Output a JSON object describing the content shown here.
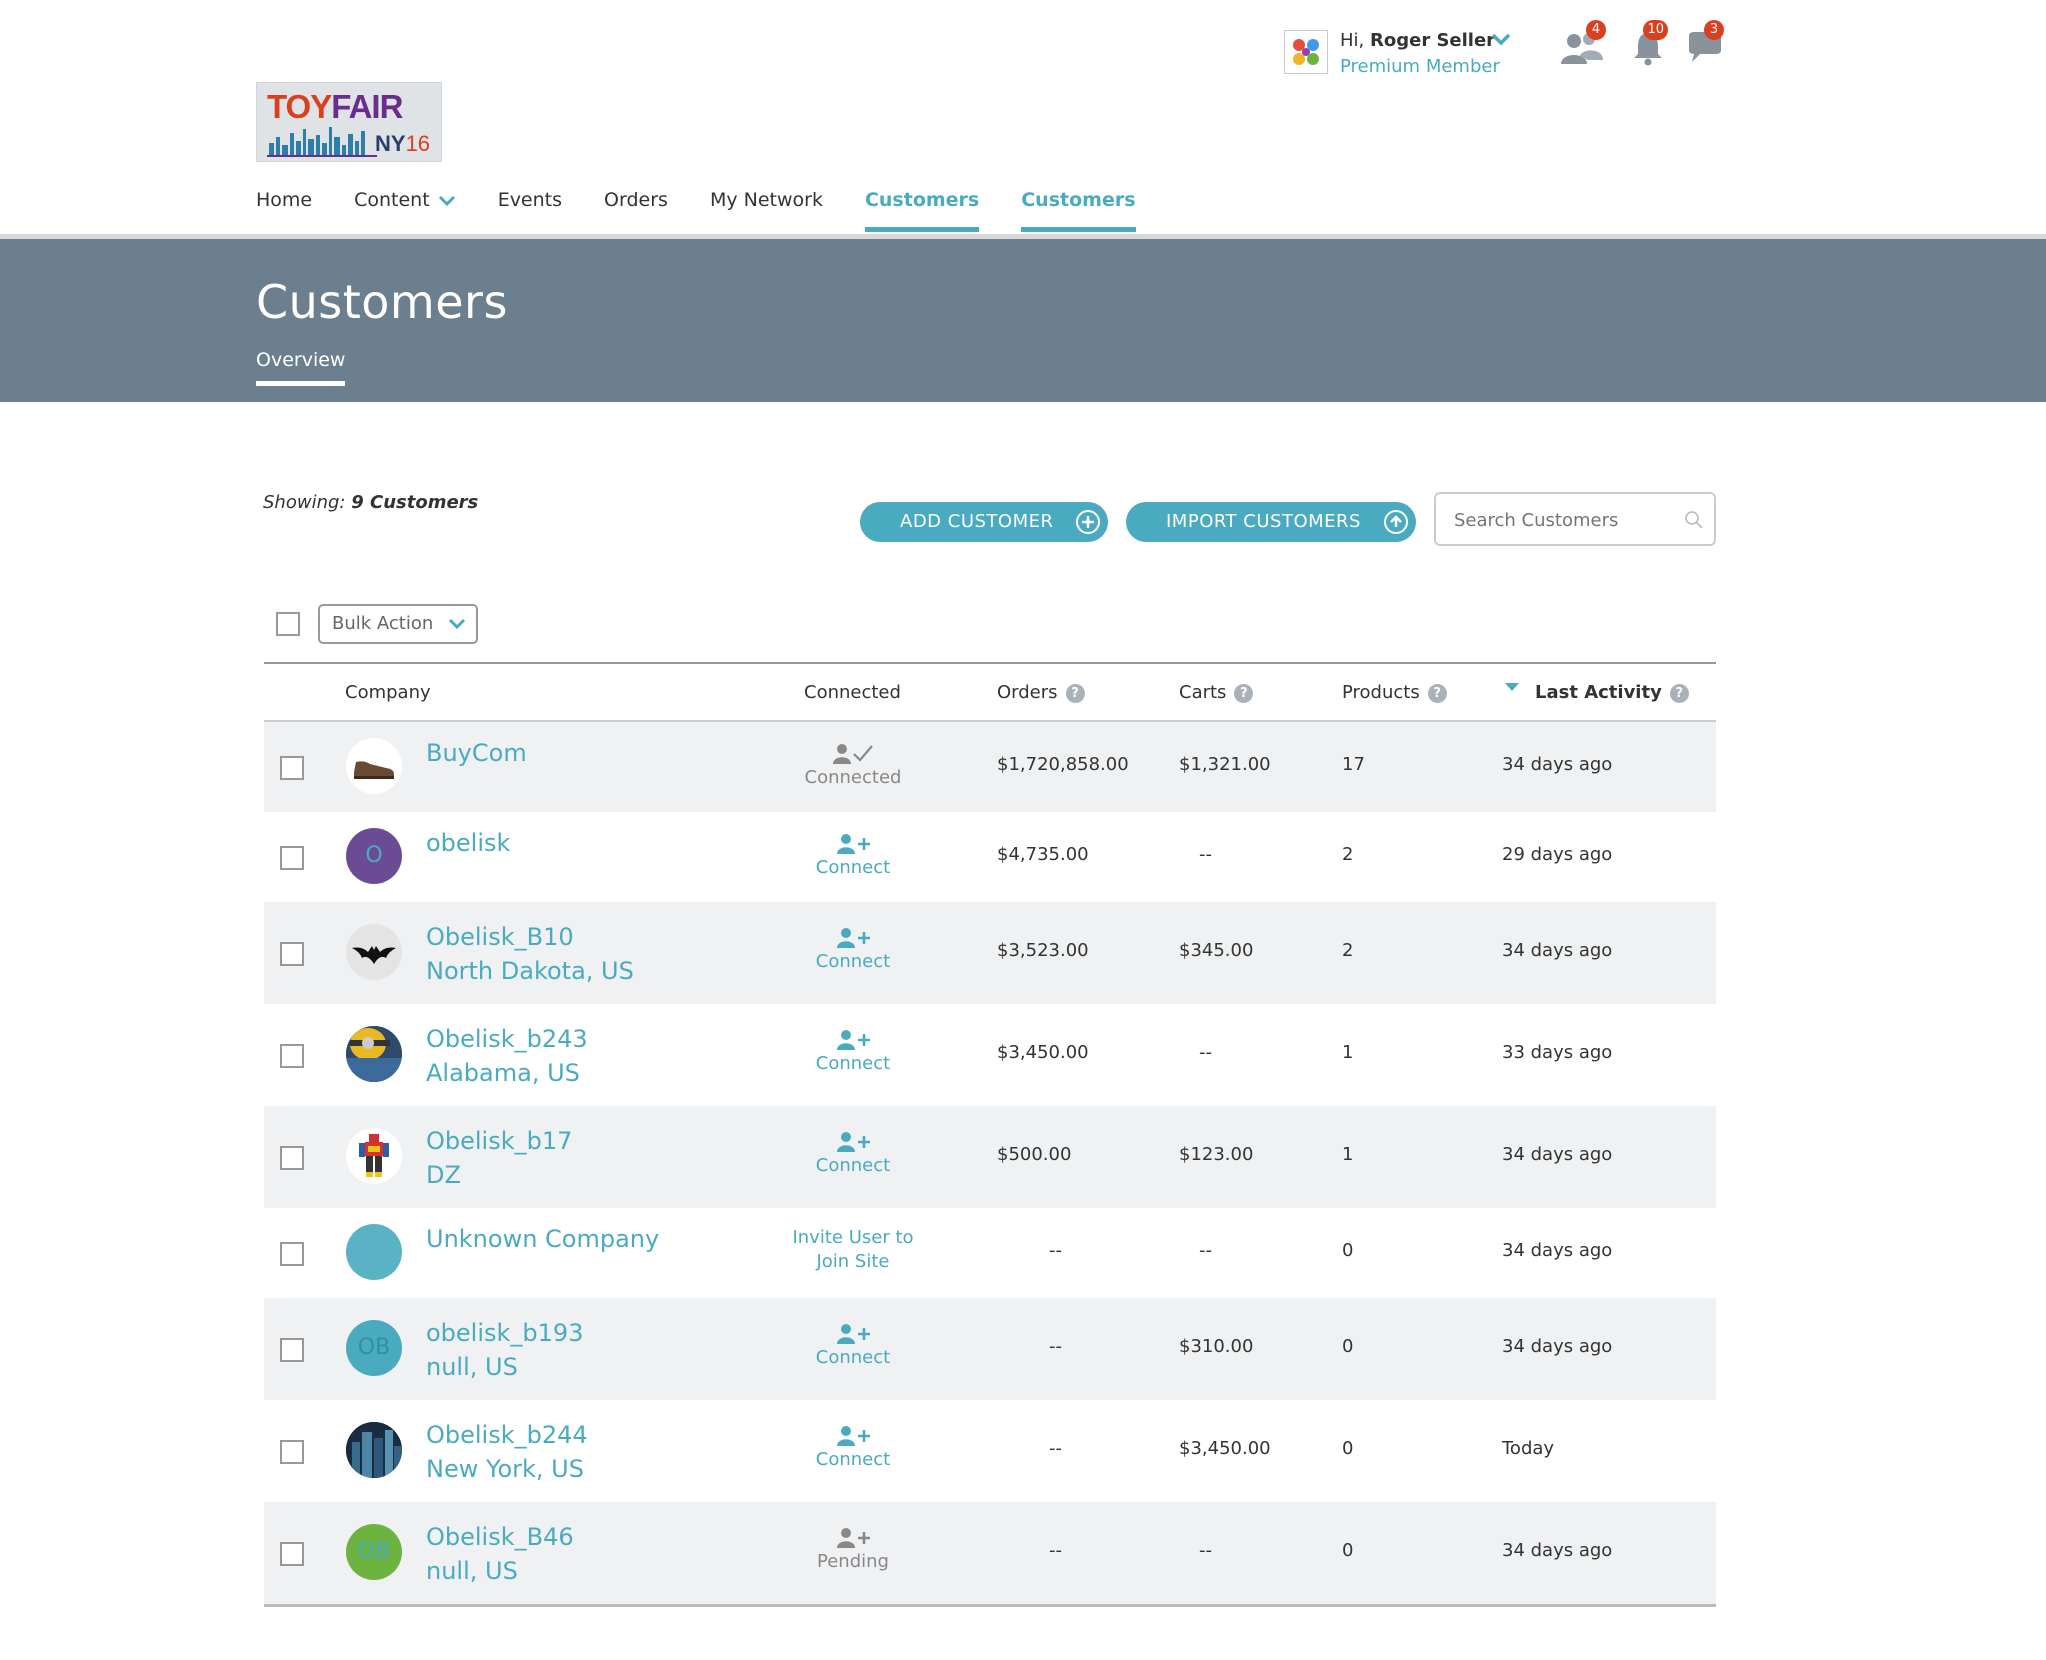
{
  "logo": {
    "toy": "TOY",
    "fair": "FAIR",
    "ny": "NY",
    "year": "16"
  },
  "user": {
    "greeting": "Hi,",
    "name": "Roger Seller",
    "level": "Premium Member"
  },
  "notifications": {
    "network": "4",
    "alerts": "10",
    "messages": "3"
  },
  "nav": [
    "Home",
    "Content",
    "Events",
    "Orders",
    "My Network",
    "Customers",
    "Customers"
  ],
  "banner": {
    "title": "Customers",
    "tab": "Overview"
  },
  "toolbar": {
    "showing_label": "Showing:",
    "showing_value": "9 Customers",
    "add_button": "ADD CUSTOMER",
    "import_button": "IMPORT CUSTOMERS",
    "search_placeholder": "Search Customers",
    "bulk_action": "Bulk Action"
  },
  "columns": {
    "company": "Company",
    "connected": "Connected",
    "orders": "Orders",
    "carts": "Carts",
    "products": "Products",
    "last_activity": "Last Activity",
    "help": "?"
  },
  "rows": [
    {
      "name": "BuyCom",
      "location": "",
      "status": "Connected",
      "orders": "$1,720,858.00",
      "carts": "$1,321.00",
      "products": "17",
      "activity": "34 days ago",
      "avatar": "shoe-image"
    },
    {
      "name": "obelisk",
      "location": "",
      "status": "Connect",
      "orders": "$4,735.00",
      "carts": "--",
      "products": "2",
      "activity": "29 days ago",
      "avatar_text": "O",
      "avatar_color": "#6b4c94"
    },
    {
      "name": "Obelisk_B10",
      "location": "North Dakota, US",
      "status": "Connect",
      "orders": "$3,523.00",
      "carts": "$345.00",
      "products": "2",
      "activity": "34 days ago",
      "avatar": "bat-image"
    },
    {
      "name": "Obelisk_b243",
      "location": "Alabama, US",
      "status": "Connect",
      "orders": "$3,450.00",
      "carts": "--",
      "products": "1",
      "activity": "33 days ago",
      "avatar": "minion-image"
    },
    {
      "name": "Obelisk_b17",
      "location": "DZ",
      "status": "Connect",
      "orders": "$500.00",
      "carts": "$123.00",
      "products": "1",
      "activity": "34 days ago",
      "avatar": "robot-image"
    },
    {
      "name": "Unknown Company",
      "location": "",
      "status": "Invite User to Join Site",
      "orders": "--",
      "carts": "--",
      "products": "0",
      "activity": "34 days ago",
      "avatar_color": "#5ab3c5"
    },
    {
      "name": "obelisk_b193",
      "location": "null, US",
      "status": "Connect",
      "orders": "--",
      "carts": "$310.00",
      "products": "0",
      "activity": "34 days ago",
      "avatar_text": "OB",
      "avatar_color": "#4aabc0"
    },
    {
      "name": "Obelisk_b244",
      "location": "New York, US",
      "status": "Connect",
      "orders": "--",
      "carts": "$3,450.00",
      "products": "0",
      "activity": "Today",
      "avatar": "city-image"
    },
    {
      "name": "Obelisk_B46",
      "location": "null, US",
      "status": "Pending",
      "orders": "--",
      "carts": "--",
      "products": "0",
      "activity": "34 days ago",
      "avatar_text": "OB",
      "avatar_color": "#6cb33f"
    }
  ],
  "colors": {
    "accent": "#4aabc0",
    "banner": "#6c7f8f",
    "badge": "#d8401f"
  }
}
